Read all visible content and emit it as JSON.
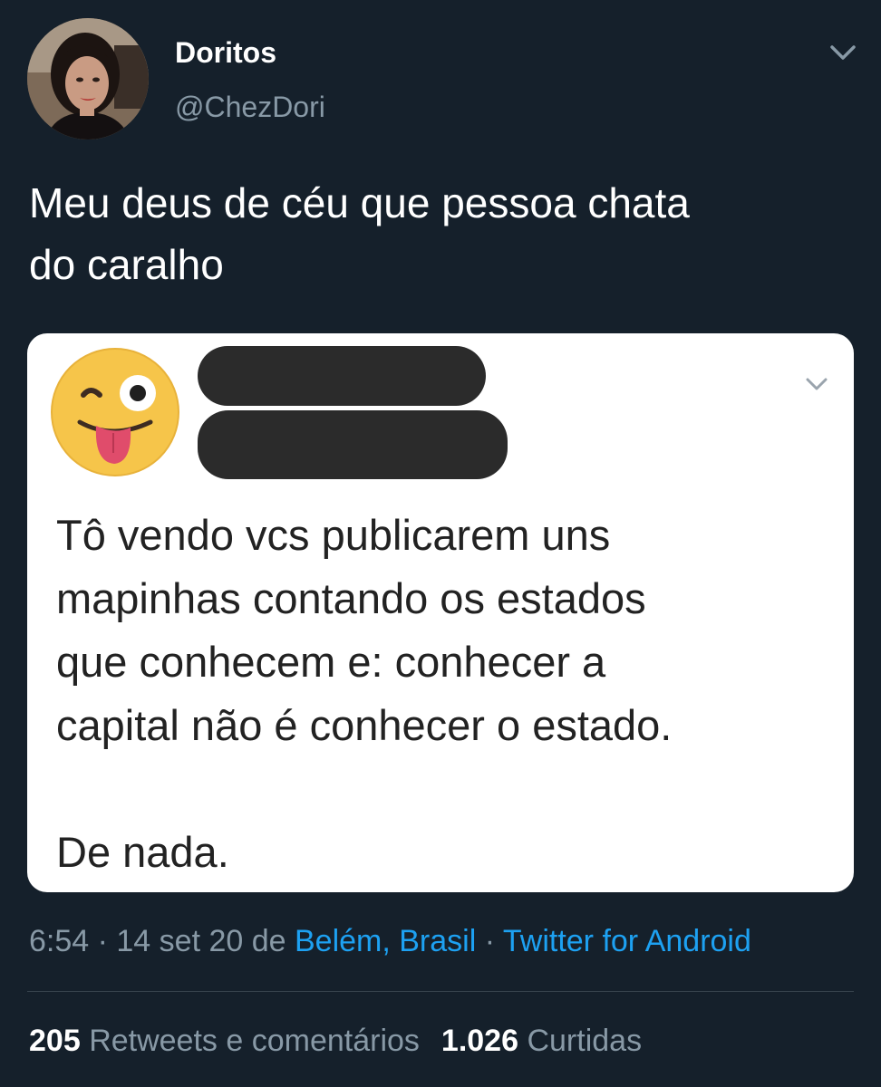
{
  "tweet": {
    "author": {
      "name": "Doritos",
      "handle": "@ChezDori",
      "avatar_icon": "profile-photo"
    },
    "text": "Meu deus de céu que pessoa chata\ndo caralho",
    "menu_icon": "chevron-down-icon",
    "embedded_image": {
      "emoji_icon": "winking-face-with-tongue",
      "redacted_name": true,
      "menu_icon": "chevron-down-icon",
      "text": "Tô vendo vcs publicarem uns\nmapinhas contando os estados\nque conhecem e: conhecer a\ncapital não é conhecer o estado.\n\nDe nada."
    },
    "meta": {
      "time_date": "6:54 · 14 set 20 de ",
      "location": "Belém, Brasil",
      "separator": " · ",
      "client": "Twitter for Android"
    },
    "stats": {
      "retweets_count": "205",
      "retweets_label": "Retweets e comentários",
      "likes_count": "1.026",
      "likes_label": "Curtidas"
    }
  },
  "colors": {
    "background": "#15202b",
    "secondary_text": "#8899a6",
    "link": "#1da1f2",
    "divider": "#38444d"
  }
}
